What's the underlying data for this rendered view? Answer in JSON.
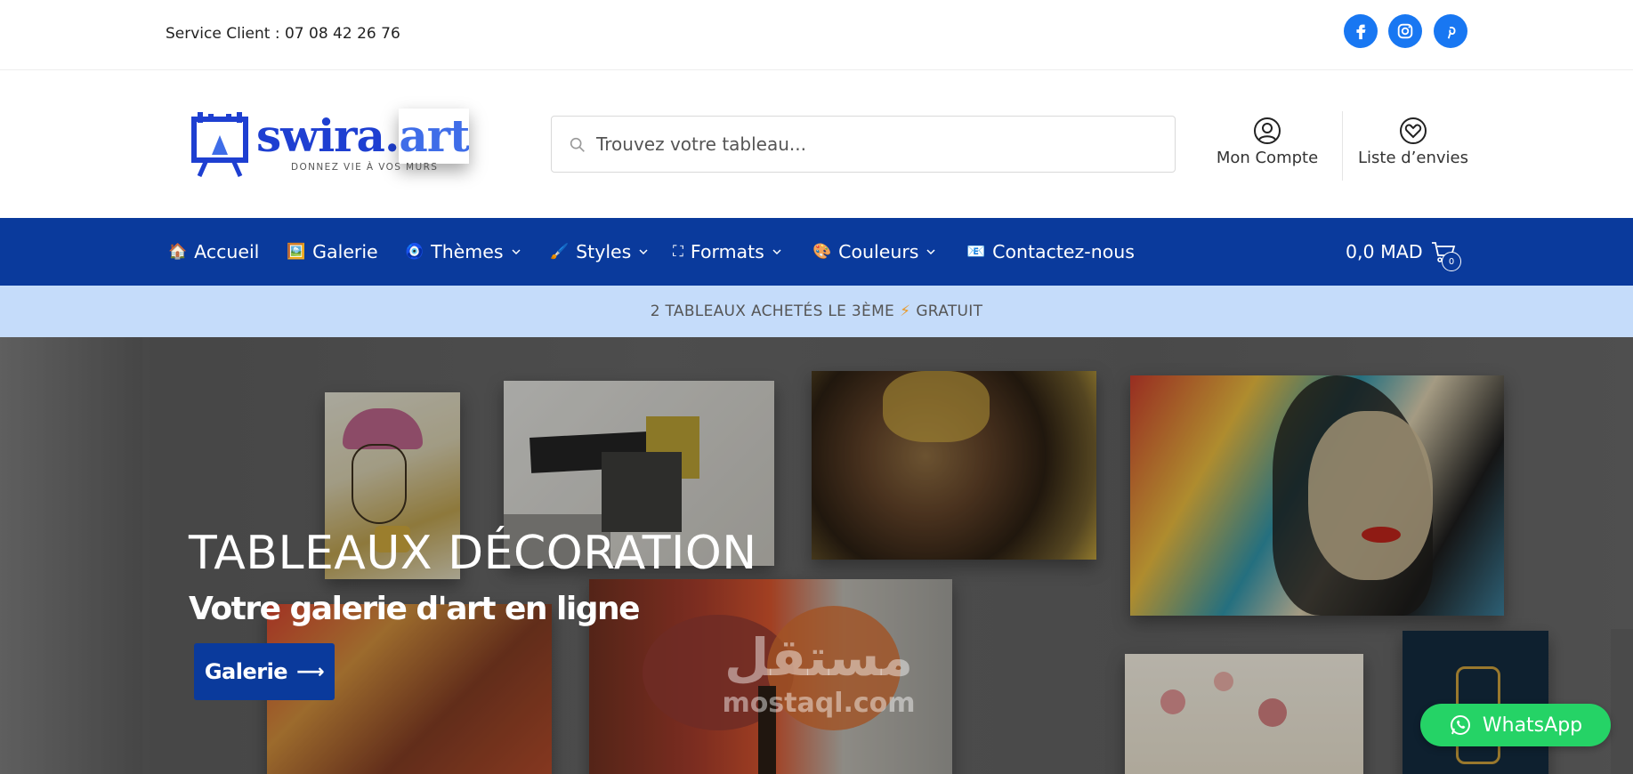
{
  "topbar": {
    "service_text": "Service Client : 07 08 42 26 76",
    "social": [
      {
        "name": "facebook-icon",
        "color": "#1877f2"
      },
      {
        "name": "instagram-icon",
        "color": "#1877f2"
      },
      {
        "name": "pinterest-icon",
        "color": "#1877f2"
      }
    ]
  },
  "header": {
    "logo": {
      "brand": "swira",
      "dot": ".",
      "tld": "art",
      "tagline": "DONNEZ VIE À VOS MURS",
      "color": "#1e3fd1"
    },
    "search": {
      "placeholder": "Trouvez votre tableau..."
    },
    "account_label": "Mon Compte",
    "wishlist_label": "Liste d’envies"
  },
  "nav": {
    "background": "#0a3a9c",
    "items": [
      {
        "icon": "🏠",
        "label": "Accueil",
        "dropdown": false
      },
      {
        "icon": "🖼️",
        "label": "Galerie",
        "dropdown": false
      },
      {
        "icon": "🧿",
        "label": "Thèmes",
        "dropdown": true
      },
      {
        "icon": "🖌️",
        "label": "Styles",
        "dropdown": true
      },
      {
        "icon": "⛶",
        "label": "Formats",
        "dropdown": true
      },
      {
        "icon": "🎨",
        "label": "Couleurs",
        "dropdown": true
      },
      {
        "icon": "📧",
        "label": "Contactez-nous",
        "dropdown": false
      }
    ],
    "cart_total": "0,0 MAD",
    "cart_count": "0"
  },
  "promo": {
    "text_before": "2 TABLEAUX ACHETÉS LE 3ÈME",
    "bolt": "⚡",
    "text_after": "GRATUIT"
  },
  "hero": {
    "title": "TABLEAUX DÉCORATION",
    "subtitle": "Votre galerie d'art en ligne",
    "button_label": "Galerie",
    "button_arrow": "⟶"
  },
  "watermark": {
    "arabic": "مستقل",
    "latin": "mostaql.com"
  },
  "whatsapp": {
    "label": "WhatsApp",
    "color": "#25d366"
  }
}
